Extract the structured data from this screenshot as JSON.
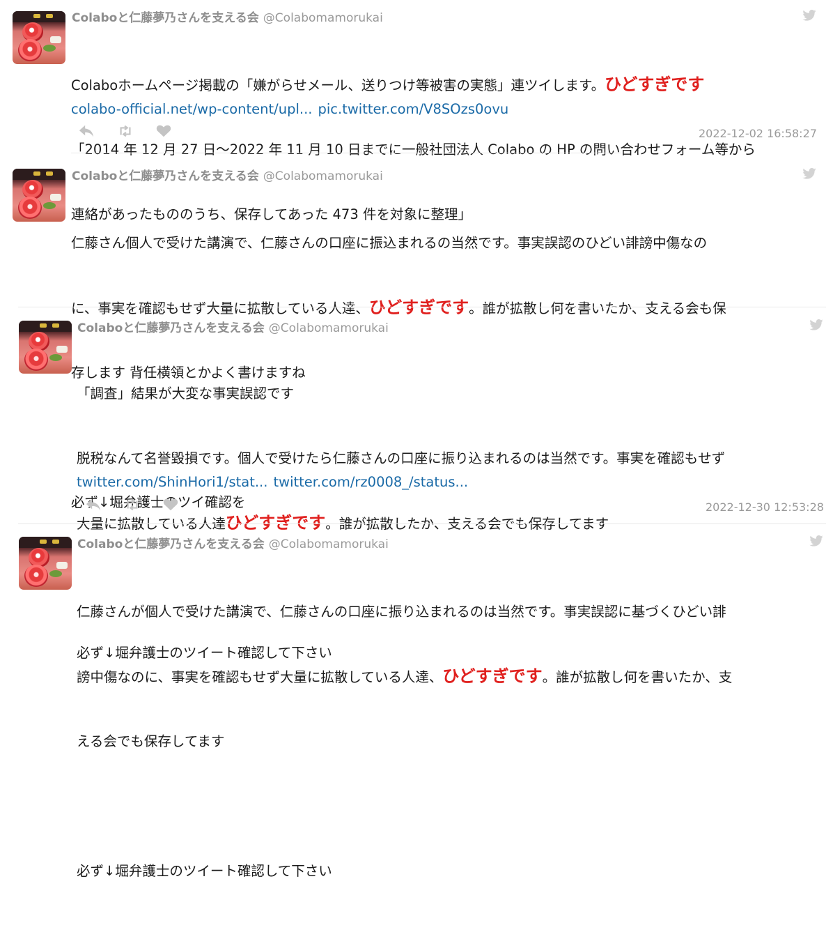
{
  "account": {
    "name": "Colaboと仁藤夢乃さんを支える会",
    "handle": "@Colabomamorukai"
  },
  "tweets": [
    {
      "line1": "Colaboホームページ掲載の「嫌がらせメール、送りつけ等被害の実態」連ツイします。",
      "em": "ひどすぎです",
      "line2": "「2014 年 12 月 27 日～2022 年 11 月 10 日までに一般社団法人 Colabo の HP の問い合わせフォーム等から",
      "line3": "連絡があったもののうち、保存してあった 473 件を対象に整理」",
      "link1": "colabo-official.net/wp-content/upl...",
      "link2": "pic.twitter.com/V8SOzs0ovu",
      "timestamp": "2022-12-02 16:58:27"
    },
    {
      "line1": "仁藤さん個人で受けた講演で、仁藤さんの口座に振込まれるの当然です。事実誤認のひどい誹謗中傷なの",
      "line2a": "に、事実を確認もせず大量に拡散している人達、",
      "em": "ひどすぎです",
      "line2b": "。誰が拡散し何を書いたか、支える会も保",
      "line3": "存します 背任横領とかよく書けますね",
      "line4": "必ず↓堀弁護士のツイ確認を"
    },
    {
      "line1": "「調査」結果が大変な事実誤認です",
      "line2": "脱税なんて名誉毀損です。個人で受けたら仁藤さんの口座に振り込まれるのは当然です。事実を確認もせず",
      "line3a": "大量に拡散している人達",
      "em": "ひどすぎです",
      "line3b": "。誰が拡散したか、支える会でも保存してます",
      "line4": "必ず↓堀弁護士のツイート確認して下さい",
      "link1": "twitter.com/ShinHori1/stat...",
      "link2": "twitter.com/rz0008_/status...",
      "timestamp": "2022-12-30 12:53:28"
    },
    {
      "line1": "仁藤さんが個人で受けた講演で、仁藤さんの口座に振り込まれるのは当然です。事実誤認に基づくひどい誹",
      "line2a": "謗中傷なのに、事実を確認もせず大量に拡散している人達、",
      "em": "ひどすぎです",
      "line2b": "。誰が拡散し何を書いたか、支",
      "line3": "える会でも保存してます",
      "line4": "必ず↓堀弁護士のツイート確認して下さい"
    }
  ],
  "icons": {
    "bird": "twitter-bird-icon",
    "reply": "reply-icon",
    "retweet": "retweet-icon",
    "like": "heart-icon"
  },
  "colors": {
    "emphasis": "#e0201e",
    "link": "#1a6aa7",
    "muted": "#9a9a9a"
  }
}
